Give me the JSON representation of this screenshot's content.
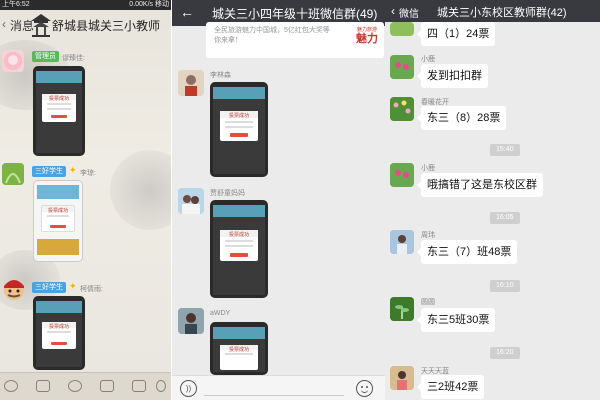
{
  "panel1": {
    "status": {
      "time": "上午6:52",
      "net": "0.00K/s",
      "carrier": "移动"
    },
    "back_label": "消息",
    "title": "舒城县城关三小教师",
    "messages": [
      {
        "badge": "管理员",
        "badge_color": "#5cb85c",
        "name": "谬臻佳:"
      },
      {
        "badge": "三好学生",
        "badge_color": "#4aa3df",
        "name": "李琼:"
      },
      {
        "badge": "三好学生",
        "badge_color": "#4aa3df",
        "name": "柯倩雨:"
      }
    ],
    "shot_caption": "投票成功"
  },
  "panel2": {
    "title": "城关三小四年级十班微信群(49)",
    "ad_text": "全民旅游魅力中国城，5亿红包大奖等你来拿！",
    "ad_logo_small": "魅力旅游",
    "ad_logo_big": "魅力",
    "names": [
      "李林森",
      "贾舒童妈妈",
      "aWDY"
    ],
    "shot_caption": "投票成功"
  },
  "panel3": {
    "back_label": "微信",
    "title": "城关三小东校区教师群(42)",
    "messages": [
      {
        "name": "",
        "text": "四（1）24票"
      },
      {
        "name": "小鹿",
        "text": "发到扣扣群"
      },
      {
        "name": "春暖花开",
        "text": "东三（8）28票"
      },
      {
        "name": "小鹿",
        "text": "哦搞错了这是东校区群"
      },
      {
        "name": "周玮",
        "text": "东三（7）班48票"
      },
      {
        "name": "圆圆",
        "text": "东三5班30票"
      },
      {
        "name": "天天天蓝",
        "text": "三2班42票"
      }
    ],
    "times": [
      "15:40",
      "16:05",
      "16:10",
      "16:20"
    ]
  }
}
